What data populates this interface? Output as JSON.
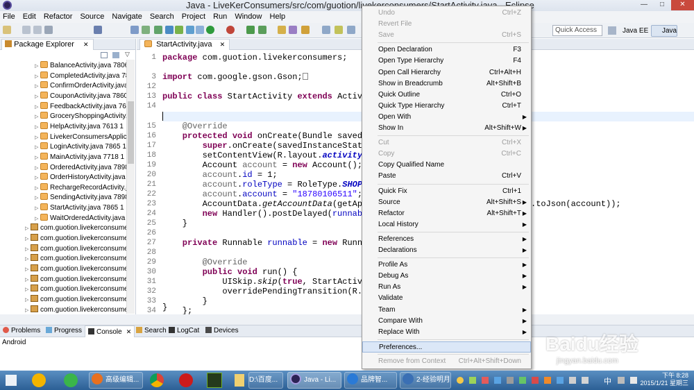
{
  "window": {
    "title": "Java - LiveKerConsumers/src/com/guotion/livekerconsumers/StartActivity.java - Eclipse",
    "controls": [
      "—",
      "□",
      "✕"
    ]
  },
  "menubar": [
    "File",
    "Edit",
    "Refactor",
    "Source",
    "Navigate",
    "Search",
    "Project",
    "Run",
    "Window",
    "Help"
  ],
  "toolbar": {
    "quick_access_placeholder": "Quick Access",
    "perspectives": [
      "Java EE",
      "Java"
    ]
  },
  "package_explorer": {
    "tab_label": "Package Explorer",
    "close_glyph": "✕",
    "files": [
      "BalanceActivity.java 7806",
      "CompletedActivity.java 78",
      "ConfirmOrderActivity.java",
      "CouponActivity.java 7860",
      "FeedbackActivity.java 761",
      "GroceryShoppingActivity.j",
      "HelpActivity.java 7613 1",
      "LivekerConsumersApplica",
      "LoginActivity.java 7865 1",
      "MainActivity.java 7718 1",
      "OrderedActivity.java 7898",
      "OrderHistoryActivity.java",
      "RechargeRecordActivity.j",
      "SendingActivity.java 7898",
      "StartActivity.java 7865 1",
      "WaitOrderedActivity.java"
    ],
    "packages": [
      "com.guotion.livekerconsume",
      "com.guotion.livekerconsume",
      "com.guotion.livekerconsume",
      "com.guotion.livekerconsume",
      "com.guotion.livekerconsume",
      "com.guotion.livekerconsume",
      "com.guotion.livekerconsume",
      "com.guotion.livekerconsume",
      "com.guotion.livekerconsume"
    ]
  },
  "editor": {
    "tab_label": "StartActivity.java",
    "close_glyph": "✕",
    "line_numbers": [
      "1",
      "3",
      "12",
      "13",
      "14",
      "15",
      "16",
      "17",
      "18",
      "19",
      "20",
      "21",
      "22",
      "23",
      "24",
      "25",
      "26",
      "27",
      "28",
      "29",
      "30",
      "31",
      "32",
      "33",
      "34",
      "35"
    ],
    "code": {
      "l1_kw": "package",
      "l1_rest": " com.guotion.livekerconsumers;",
      "l3_kw": "import",
      "l3_rest": " com.google.gson.Gson;",
      "l13_kw1": "public class",
      "l13_mid": " StartActivity ",
      "l13_kw2": "extends",
      "l13_rest": " Activity",
      "l15_ann": "    @Override",
      "l16_kw": "    protected void",
      "l16_rest": " onCreate(Bundle savedInst",
      "l17_kw": "        super",
      "l17_rest": ".onCreate(savedInstanceState);",
      "l18_a": "        setContentView(R.layout.",
      "l18_b": "activity_sta",
      "l19_a": "        Account ",
      "l19_b": "account",
      "l19_c": " = ",
      "l19_d": "new",
      "l19_e": " Account();",
      "l20_a": "        ",
      "l20_b": "account",
      "l20_c": ".",
      "l20_d": "id",
      "l20_e": " = 1;",
      "l21_b": "account",
      "l21_d": "roleType",
      "l21_e": " = RoleType.",
      "l21_f": "SHOP",
      "l21_g": ";",
      "l22_b": "account",
      "l22_d": "account",
      "l22_e": " = ",
      "l22_f": "\"18780106511\"",
      "l22_g": ";",
      "l23_a": "        AccountData.",
      "l23_b": "getAccountData",
      "l23_c": "(getApplic",
      "l23_right": ".toJson(account));",
      "l24_kw": "        new",
      "l24_a": " Handler().postDelayed(",
      "l24_b": "runnable",
      "l24_c": ", ",
      "l25": "    }",
      "l27_kw": "    private",
      "l27_a": " Runnable ",
      "l27_b": "runnable",
      "l27_c": " = ",
      "l27_kw2": "new",
      "l27_d": " Runnable",
      "l29_ann": "        @Override",
      "l30_kw": "        public void",
      "l30_rest": " run() {",
      "l31_a": "            UISkip.",
      "l31_b": "skip",
      "l31_c": "(",
      "l31_kw": "true",
      "l31_d": ", StartActivity.",
      "l32": "            overridePendingTransition(R.anim",
      "l33": "        }",
      "l34": "    };",
      "l35": "}"
    }
  },
  "context_menu": {
    "items": [
      {
        "label": "Undo",
        "accel": "Ctrl+Z",
        "disabled": true
      },
      {
        "label": "Revert File",
        "accel": "",
        "disabled": true
      },
      {
        "label": "Save",
        "accel": "Ctrl+S",
        "disabled": true
      },
      {
        "sep": true
      },
      {
        "label": "Open Declaration",
        "accel": "F3"
      },
      {
        "label": "Open Type Hierarchy",
        "accel": "F4"
      },
      {
        "label": "Open Call Hierarchy",
        "accel": "Ctrl+Alt+H"
      },
      {
        "label": "Show in Breadcrumb",
        "accel": "Alt+Shift+B"
      },
      {
        "label": "Quick Outline",
        "accel": "Ctrl+O"
      },
      {
        "label": "Quick Type Hierarchy",
        "accel": "Ctrl+T"
      },
      {
        "label": "Open With",
        "accel": "",
        "submenu": true
      },
      {
        "label": "Show In",
        "accel": "Alt+Shift+W",
        "submenu": true
      },
      {
        "sep": true
      },
      {
        "label": "Cut",
        "accel": "Ctrl+X",
        "disabled": true
      },
      {
        "label": "Copy",
        "accel": "Ctrl+C",
        "disabled": true
      },
      {
        "label": "Copy Qualified Name",
        "accel": ""
      },
      {
        "label": "Paste",
        "accel": "Ctrl+V"
      },
      {
        "sep": true
      },
      {
        "label": "Quick Fix",
        "accel": "Ctrl+1"
      },
      {
        "label": "Source",
        "accel": "Alt+Shift+S",
        "submenu": true
      },
      {
        "label": "Refactor",
        "accel": "Alt+Shift+T",
        "submenu": true
      },
      {
        "label": "Local History",
        "accel": "",
        "submenu": true
      },
      {
        "sep": true
      },
      {
        "label": "References",
        "accel": "",
        "submenu": true
      },
      {
        "label": "Declarations",
        "accel": "",
        "submenu": true
      },
      {
        "sep": true
      },
      {
        "label": "Profile As",
        "accel": "",
        "submenu": true
      },
      {
        "label": "Debug As",
        "accel": "",
        "submenu": true
      },
      {
        "label": "Run As",
        "accel": "",
        "submenu": true
      },
      {
        "label": "Validate",
        "accel": ""
      },
      {
        "label": "Team",
        "accel": "",
        "submenu": true
      },
      {
        "label": "Compare With",
        "accel": "",
        "submenu": true
      },
      {
        "label": "Replace With",
        "accel": "",
        "submenu": true
      },
      {
        "sep": true
      },
      {
        "label": "Preferences...",
        "accel": "",
        "highlighted": true
      },
      {
        "sep": true
      },
      {
        "label": "Remove from Context",
        "accel": "Ctrl+Alt+Shift+Down",
        "disabled": true
      }
    ]
  },
  "bottom_panel": {
    "tabs": [
      "Problems",
      "Progress",
      "Console",
      "Search",
      "LogCat",
      "Devices"
    ],
    "console_text": "Android"
  },
  "taskbar": {
    "tasks": [
      "高级编辑...",
      "D:\\百度...",
      "Java - Li...",
      "品牌智...",
      "2-经验明月"
    ],
    "clock_time": "下午 8:28",
    "clock_date": "2015/1/21 星期三",
    "tray_lang": "中"
  },
  "watermark": {
    "brand": "Baidu经验",
    "url": "jingyan.baidu.com"
  },
  "colors": {
    "keyword": "#7f0055",
    "string": "#2a00ff",
    "field": "#0000c0",
    "annotation": "#646464",
    "menu_highlight": "#dbe7f7"
  }
}
